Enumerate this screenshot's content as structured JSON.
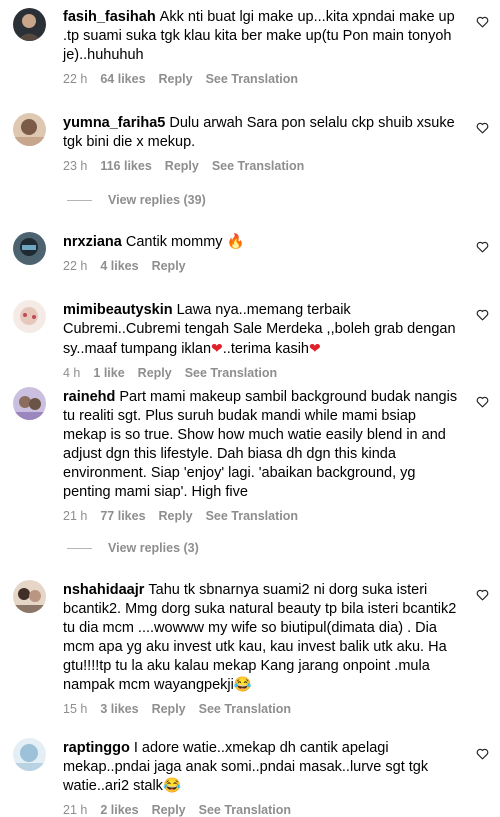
{
  "comments": [
    {
      "username": "fasih_fasihah",
      "text": "Akk nti buat lgi make up...kita xpndai make up .tp suami suka tgk klau kita ber make up(tu Pon main tonyoh je)..huhuhuh",
      "time": "22 h",
      "likes": "64 likes",
      "reply": "Reply",
      "translate": "See Translation"
    },
    {
      "username": "yumna_fariha5",
      "text": "Dulu arwah Sara pon selalu ckp shuib xsuke tgk bini die x mekup.",
      "time": "23 h",
      "likes": "116 likes",
      "reply": "Reply",
      "translate": "See Translation",
      "view_replies": "View replies (39)"
    },
    {
      "username": "nrxziana",
      "text": "Cantik mommy",
      "emoji": "🔥",
      "time": "22 h",
      "likes": "4 likes",
      "reply": "Reply"
    },
    {
      "username": "mimibeautyskin",
      "text_a": "Lawa nya..memang terbaik Cubremi..Cubremi tengah Sale Merdeka ,,boleh grab dengan sy..maaf tumpang iklan",
      "text_b": "..terima kasih",
      "emoji": "❤",
      "time": "4 h",
      "likes": "1 like",
      "reply": "Reply",
      "translate": "See Translation"
    },
    {
      "username": "rainehd",
      "text": "Part mami makeup sambil background budak nangis tu realiti sgt. Plus suruh budak mandi while mami bsiap mekap is so true. Show how much watie easily blend in and adjust dgn this lifestyle. Dah biasa dh dgn this kinda environment. Siap 'enjoy' lagi. 'abaikan background, yg penting mami siap'. High five",
      "time": "21 h",
      "likes": "77 likes",
      "reply": "Reply",
      "translate": "See Translation",
      "view_replies": "View replies (3)"
    },
    {
      "username": "nshahidaajr",
      "text": "Tahu tk sbnarnya suami2 ni dorg suka isteri bcantik2. Mmg dorg suka natural beauty tp bila isteri bcantik2 tu dia mcm ....wowww my wife so biutipul(dimata dia) . Dia mcm apa yg aku invest utk kau, kau invest balik utk aku. Ha gtu!!!!tp tu la aku kalau mekap Kang jarang onpoint .mula nampak mcm wayangpekji",
      "emoji": "😂",
      "time": "15 h",
      "likes": "3 likes",
      "reply": "Reply",
      "translate": "See Translation"
    },
    {
      "username": "raptinggo",
      "text": "I adore watie..xmekap dh cantik apelagi mekap..pndai jaga anak somi..pndai masak..lurve sgt tgk watie..ari2 stalk",
      "emoji": "😂",
      "time": "21 h",
      "likes": "2 likes",
      "reply": "Reply",
      "translate": "See Translation"
    }
  ],
  "colors": {
    "meta": "#8e8e8e",
    "heart_emoji": "#e0202a"
  },
  "icons": {
    "like": "heart-outline-icon"
  }
}
